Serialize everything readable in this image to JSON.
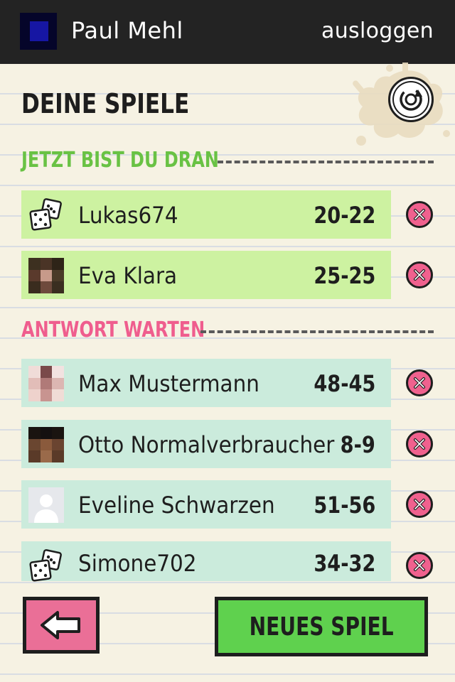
{
  "header": {
    "user_name": "Paul Mehl",
    "logout_label": "ausloggen",
    "avatar_icon": "user-avatar-pixelated"
  },
  "page": {
    "title": "DEINE SPIELE",
    "refresh_icon": "refresh-icon"
  },
  "sections": {
    "your_turn": {
      "label": "JETZT BIST DU DRAN",
      "color": "#69c244",
      "games": [
        {
          "name": "Lukas674",
          "score": "20-22",
          "avatar": "dice-icon"
        },
        {
          "name": "Eva Klara",
          "score": "25-25",
          "avatar": "photo-avatar"
        }
      ]
    },
    "waiting": {
      "label": "ANTWORT WARTEN",
      "color": "#ef5d8e",
      "games": [
        {
          "name": "Max Mustermann",
          "score": "48-45",
          "avatar": "photo-avatar"
        },
        {
          "name": "Otto Normalverbraucher",
          "score": "8-9",
          "avatar": "photo-avatar"
        },
        {
          "name": "Eveline Schwarzen",
          "score": "51-56",
          "avatar": "default-user-icon"
        },
        {
          "name": "Simone702",
          "score": "34-32",
          "avatar": "dice-icon"
        }
      ]
    }
  },
  "footer": {
    "back_icon": "arrow-left-icon",
    "new_game_label": "NEUES SPIEL"
  },
  "colors": {
    "topbar": "#232323",
    "your_turn_row": "#cdf2a1",
    "waiting_row": "#cbebdc",
    "delete_button": "#f0618e",
    "back_button": "#ea6f97",
    "new_game_button": "#5fd14e"
  }
}
